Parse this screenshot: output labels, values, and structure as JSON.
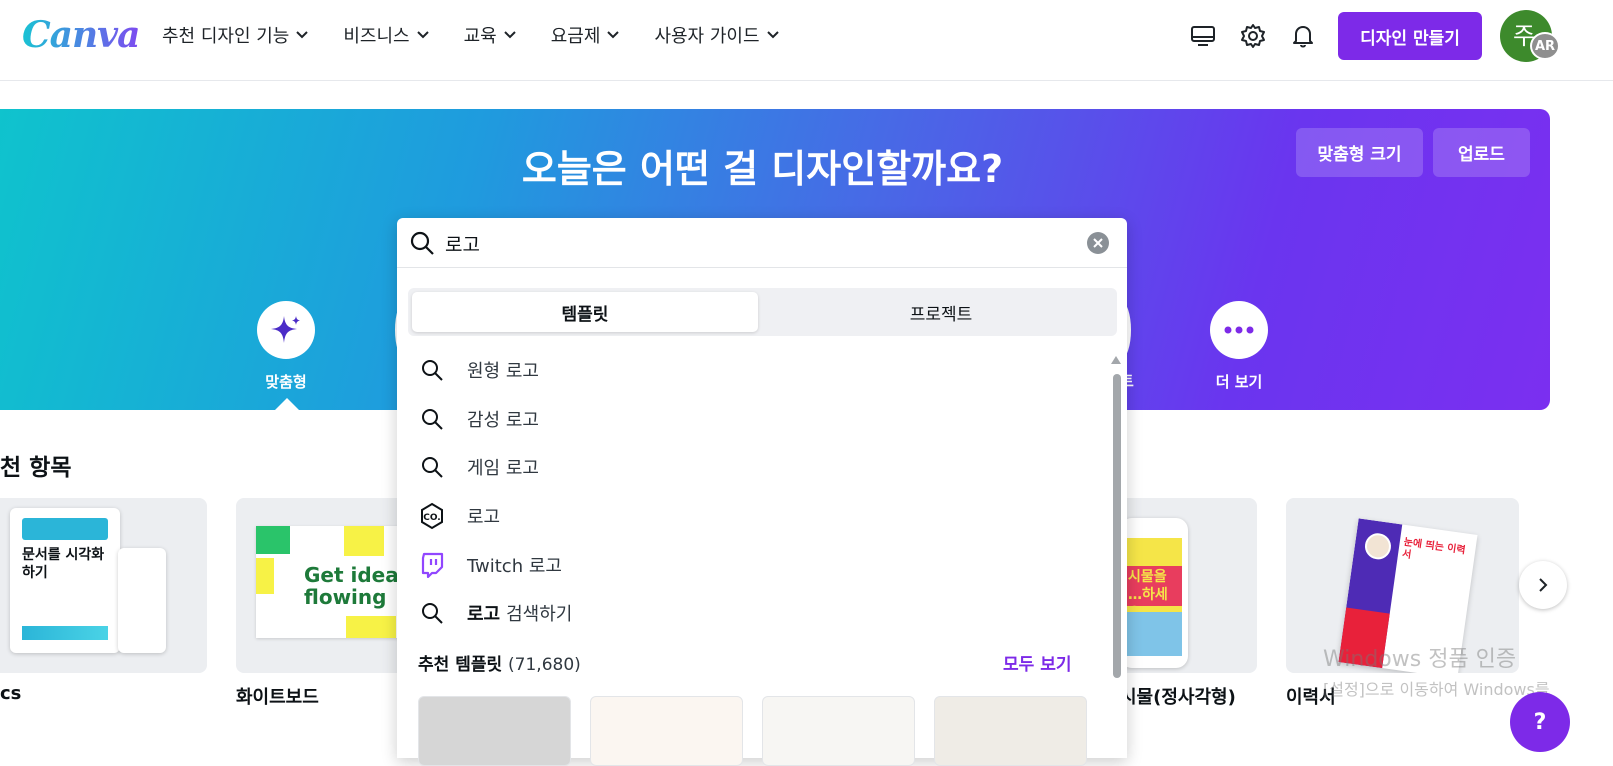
{
  "header": {
    "logo": "Canva",
    "nav": [
      {
        "label": "추천 디자인 기능"
      },
      {
        "label": "비즈니스"
      },
      {
        "label": "교육"
      },
      {
        "label": "요금제"
      },
      {
        "label": "사용자 가이드"
      }
    ],
    "icons": [
      "desktop-icon",
      "gear-icon",
      "bell-icon"
    ],
    "create_button": "디자인 만들기",
    "avatar_letter": "주",
    "avatar_badge": "AR",
    "brand_color": "#7d2ae8"
  },
  "hero": {
    "title": "오늘은 어떤 걸 디자인할까요?",
    "custom_size_button": "맞춤형 크기",
    "upload_button": "업로드",
    "categories": [
      {
        "label": "맞춤형",
        "icon": "sparkle-icon"
      },
      {
        "label": "더 보기",
        "icon": "more-icon"
      }
    ],
    "partial_category_label": "트"
  },
  "recommended": {
    "title": "천 항목",
    "cards": [
      {
        "label": "cs",
        "text": "문서를 시각화하기"
      },
      {
        "label": "화이트보드",
        "text": "Get ideas flowing"
      },
      {
        "label": "시물(정사각형)",
        "text": "시물을 …하세요"
      },
      {
        "label": "이력서",
        "text": "눈에 띄는 이력서"
      }
    ]
  },
  "search_dropdown": {
    "query": "로고",
    "tabs": [
      {
        "label": "템플릿",
        "active": true
      },
      {
        "label": "프로젝트",
        "active": false
      }
    ],
    "suggestions": [
      {
        "text": "원형 로고",
        "icon": "search-icon"
      },
      {
        "text": "감성 로고",
        "icon": "search-icon"
      },
      {
        "text": "게임 로고",
        "icon": "search-icon"
      },
      {
        "text": "로고",
        "icon": "logo-badge-icon"
      },
      {
        "text": "Twitch 로고",
        "icon": "twitch-icon"
      },
      {
        "bold": "로고",
        "text": "검색하기",
        "icon": "search-icon"
      }
    ],
    "recommended_templates_label": "추천 템플릿",
    "recommended_templates_count": "(71,680)",
    "see_all": "모두 보기",
    "twitch_color": "#9146ff"
  },
  "watermark": {
    "line1": "Windows 정품 인증",
    "line2": "[설정]으로 이동하여 Windows를"
  },
  "help_button": "?"
}
